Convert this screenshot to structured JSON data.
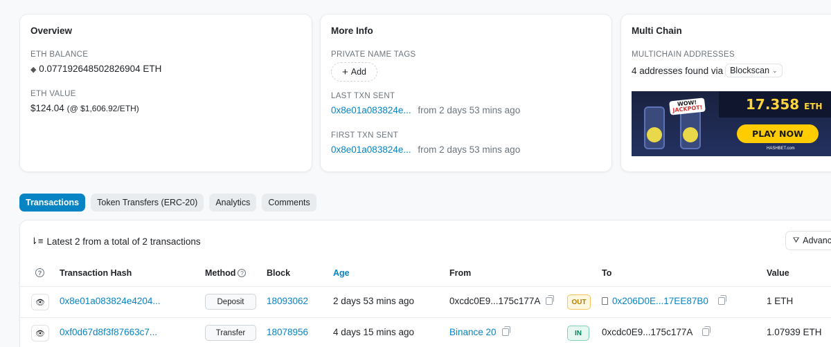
{
  "overview": {
    "title": "Overview",
    "eth_balance_label": "ETH BALANCE",
    "eth_balance_value": "0.077192648502826904 ETH",
    "eth_value_label": "ETH VALUE",
    "eth_value_amount": "$124.04",
    "eth_value_rate": "(@ $1,606.92/ETH)"
  },
  "more_info": {
    "title": "More Info",
    "private_tags_label": "PRIVATE NAME TAGS",
    "add_label": "Add",
    "last_txn_label": "LAST TXN SENT",
    "last_txn_hash": "0x8e01a083824e...",
    "last_txn_time": "from 2 days 53 mins ago",
    "first_txn_label": "FIRST TXN SENT",
    "first_txn_hash": "0x8e01a083824e...",
    "first_txn_time": "from 2 days 53 mins ago"
  },
  "multi_chain": {
    "title": "Multi Chain",
    "addresses_label": "MULTICHAIN ADDRESSES",
    "addresses_found": "4 addresses found via",
    "selector": "Blockscan",
    "banner": {
      "jackpot_top": "WOW!",
      "jackpot_text": "JACKPOT!",
      "amount": "17.358",
      "amount_unit": "ETH",
      "cta": "PLAY NOW",
      "brand": "HASHBET.com"
    }
  },
  "tabs": [
    "Transactions",
    "Token Transfers (ERC-20)",
    "Analytics",
    "Comments"
  ],
  "transactions": {
    "summary": "Latest 2 from a total of 2 transactions",
    "advanced_label": "Advanc",
    "columns": {
      "hash": "Transaction Hash",
      "method": "Method",
      "block": "Block",
      "age": "Age",
      "from": "From",
      "to": "To",
      "value": "Value"
    },
    "rows": [
      {
        "hash": "0x8e01a083824e4204...",
        "method": "Deposit",
        "block": "18093062",
        "age": "2 days 53 mins ago",
        "from": "0xcdc0E9...175c177A",
        "direction": "OUT",
        "to": "0x206D0E...17EE87B0",
        "value": "1 ETH"
      },
      {
        "hash": "0xf0d67d8f3f87663c7...",
        "method": "Transfer",
        "block": "18078956",
        "age": "4 days 15 mins ago",
        "from": "Binance 20",
        "direction": "IN",
        "to": "0xcdc0E9...175c177A",
        "value": "1.07939 ETH"
      }
    ]
  },
  "colors": {
    "accent": "#0784c3",
    "out": "#b57c00",
    "in": "#00875a"
  }
}
